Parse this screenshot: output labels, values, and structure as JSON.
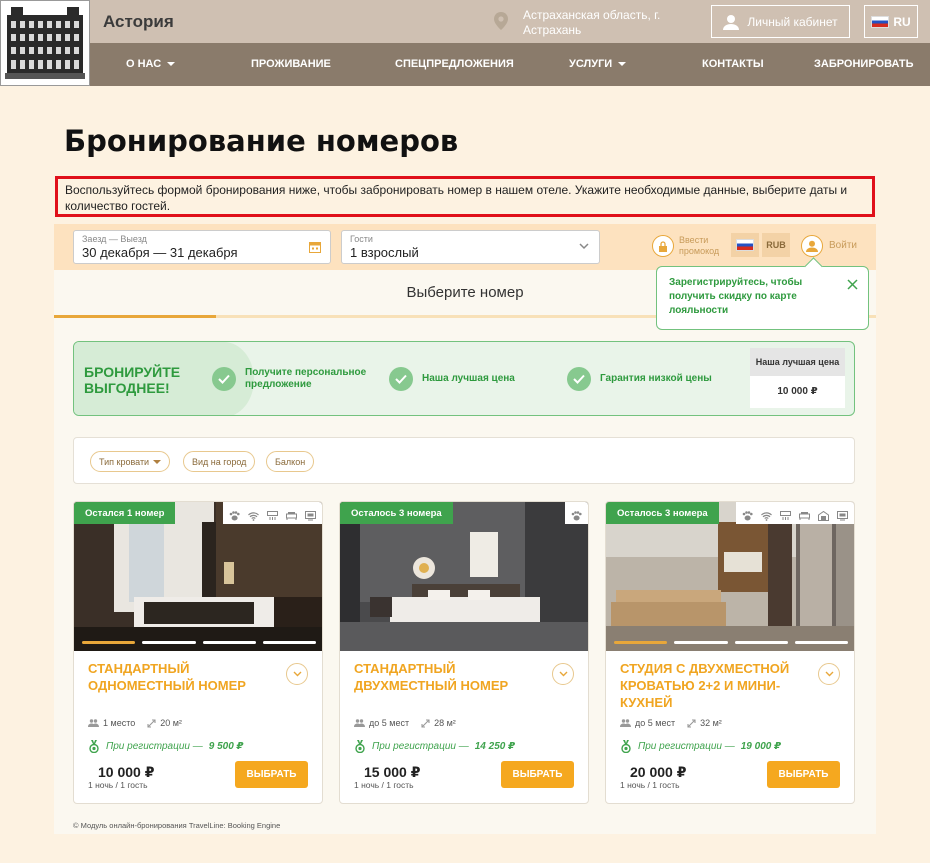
{
  "header": {
    "brand": "Астория",
    "location": "Астраханская область, г. Астрахань",
    "cabinet": "Личный кабинет",
    "lang": "RU",
    "nav": [
      {
        "label": "О НАС"
      },
      {
        "label": "ПРОЖИВАНИЕ"
      },
      {
        "label": "СПЕЦПРЕДЛОЖЕНИЯ"
      },
      {
        "label": "УСЛУГИ"
      },
      {
        "label": "КОНТАКТЫ"
      },
      {
        "label": "ЗАБРОНИРОВАТЬ"
      }
    ]
  },
  "page": {
    "title": "Бронирование номеров",
    "intro": "Воспользуйтесь формой бронирования ниже, чтобы забронировать номер в нашем отеле. Укажите необходимые данные, выберите даты и количество гостей."
  },
  "search": {
    "dates_label": "Заезд — Выезд",
    "dates_value": "30 декабря — 31 декабря",
    "guests_label": "Гости",
    "guests_value": "1 взрослый",
    "promo_line1": "Ввести",
    "promo_line2": "промокод",
    "currency": "RUB",
    "login": "Войти",
    "tooltip": "Зарегистрируйтесь, чтобы получить скидку по карте лояльности"
  },
  "step": {
    "title": "Выберите номер"
  },
  "promo": {
    "headline_1": "БРОНИРУЙТЕ",
    "headline_2": "ВЫГОДНЕЕ!",
    "benefits": [
      {
        "line1": "Получите персональное",
        "line2": "предложение"
      },
      {
        "line1": "Наша лучшая цена",
        "line2": ""
      },
      {
        "line1": "Гарантия низкой цены",
        "line2": ""
      }
    ],
    "best_label": "Наша лучшая цена",
    "best_value": "10 000 ₽"
  },
  "filters": [
    {
      "label": "Тип кровати"
    },
    {
      "label": "Вид на город"
    },
    {
      "label": "Балкон"
    }
  ],
  "rooms": [
    {
      "badge": "Остался 1 номер",
      "name": "Стандартный одноместный номер",
      "capacity": "1 место",
      "area": "20 м²",
      "reg_label": "При регистрации —",
      "reg_price": "9 500 ₽",
      "price": "10 000 ₽",
      "per": "1 ночь / 1 гость",
      "cta": "ВЫБРАТЬ"
    },
    {
      "badge": "Осталось 3 номера",
      "name": "Стандартный двухместный номер",
      "capacity": "до 5 мест",
      "area": "28 м²",
      "reg_label": "При регистрации —",
      "reg_price": "14 250 ₽",
      "price": "15 000 ₽",
      "per": "1 ночь / 1 гость",
      "cta": "ВЫБРАТЬ"
    },
    {
      "badge": "Осталось 3 номера",
      "name": "Студия с двухместной кроватью 2+2 и мини-кухней",
      "capacity": "до 5 мест",
      "area": "32 м²",
      "reg_label": "При регистрации —",
      "reg_price": "19 000 ₽",
      "price": "20 000 ₽",
      "per": "1 ночь / 1 гость",
      "cta": "ВЫБРАТЬ"
    }
  ],
  "footer": {
    "note": "© Модуль онлайн-бронирования TravelLine: Booking Engine"
  },
  "colors": {
    "accent": "#f5a81f",
    "green": "#3fa34d",
    "alert": "#e0101a",
    "header": "#8a7b6b"
  }
}
